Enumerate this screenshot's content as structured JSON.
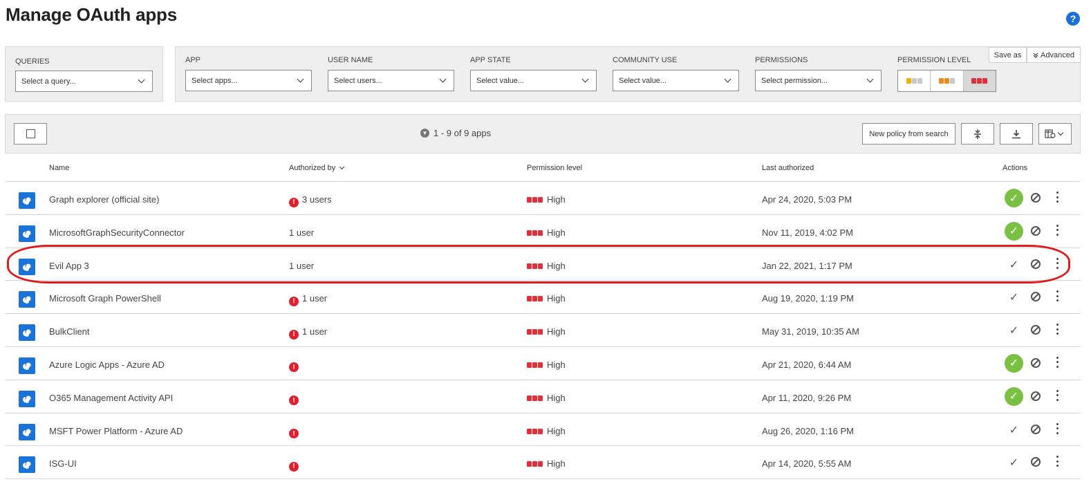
{
  "page": {
    "title": "Manage OAuth apps",
    "help_icon": "?"
  },
  "filters": {
    "queries": {
      "label": "QUERIES",
      "placeholder": "Select a query..."
    },
    "app": {
      "label": "APP",
      "placeholder": "Select apps..."
    },
    "user_name": {
      "label": "USER NAME",
      "placeholder": "Select users..."
    },
    "app_state": {
      "label": "APP STATE",
      "placeholder": "Select value..."
    },
    "community_use": {
      "label": "COMMUNITY USE",
      "placeholder": "Select value..."
    },
    "permissions": {
      "label": "PERMISSIONS",
      "placeholder": "Select permission..."
    },
    "permission_level": {
      "label": "PERMISSION LEVEL",
      "options": [
        {
          "name": "low",
          "colors": [
            "#f0b400",
            "#c8c8c8",
            "#c8c8c8"
          ]
        },
        {
          "name": "medium",
          "colors": [
            "#f08c1e",
            "#f08c1e",
            "#c8c8c8"
          ]
        },
        {
          "name": "high",
          "colors": [
            "#e0303c",
            "#e0303c",
            "#e0303c"
          ],
          "selected": true
        }
      ]
    },
    "save_as": "Save as",
    "advanced": "Advanced"
  },
  "toolbar": {
    "count_text": "1 - 9 of 9 apps",
    "new_policy": "New policy from search"
  },
  "table": {
    "columns": {
      "name": "Name",
      "authorized_by": "Authorized by",
      "permission_level": "Permission level",
      "last_authorized": "Last authorized",
      "actions": "Actions"
    },
    "rows": [
      {
        "name": "Graph explorer (official site)",
        "warn": true,
        "authorized_by": "3 users",
        "permission": "High",
        "last_authorized": "Apr 24, 2020, 5:03 PM",
        "approved": true
      },
      {
        "name": "MicrosoftGraphSecurityConnector",
        "warn": false,
        "authorized_by": "1 user",
        "permission": "High",
        "last_authorized": "Nov 11, 2019, 4:02 PM",
        "approved": true
      },
      {
        "name": "Evil App 3",
        "warn": false,
        "authorized_by": "1 user",
        "permission": "High",
        "last_authorized": "Jan 22, 2021, 1:17 PM",
        "approved": false,
        "highlighted": true
      },
      {
        "name": "Microsoft Graph PowerShell",
        "warn": true,
        "authorized_by": "1 user",
        "permission": "High",
        "last_authorized": "Aug 19, 2020, 1:19 PM",
        "approved": false
      },
      {
        "name": "BulkClient",
        "warn": true,
        "authorized_by": "1 user",
        "permission": "High",
        "last_authorized": "May 31, 2019, 10:35 AM",
        "approved": false
      },
      {
        "name": "Azure Logic Apps - Azure AD",
        "warn": true,
        "authorized_by": "",
        "permission": "High",
        "last_authorized": "Apr 21, 2020, 6:44 AM",
        "approved": true
      },
      {
        "name": "O365 Management Activity API",
        "warn": true,
        "authorized_by": "",
        "permission": "High",
        "last_authorized": "Apr 11, 2020, 9:26 PM",
        "approved": true
      },
      {
        "name": "MSFT Power Platform - Azure AD",
        "warn": true,
        "authorized_by": "",
        "permission": "High",
        "last_authorized": "Aug 26, 2020, 1:16 PM",
        "approved": false
      },
      {
        "name": "ISG-UI",
        "warn": true,
        "authorized_by": "",
        "permission": "High",
        "last_authorized": "Apr 14, 2020, 5:55 AM",
        "approved": false
      }
    ]
  },
  "colors": {
    "accent": "#1a73d9",
    "danger": "#e0303c",
    "approved": "#7ac143",
    "highlight_outline": "#e01b1b"
  }
}
